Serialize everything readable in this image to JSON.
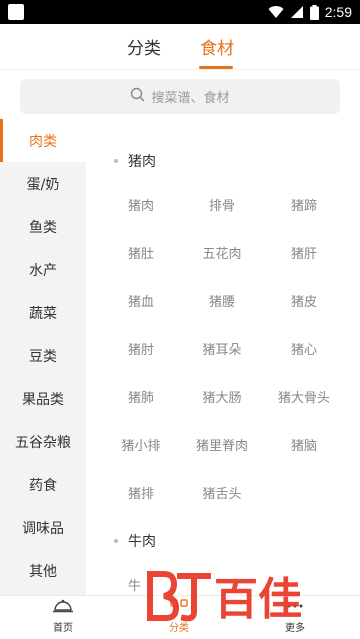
{
  "status_bar": {
    "time": "2:59"
  },
  "top_tabs": [
    {
      "label": "分类",
      "active": false
    },
    {
      "label": "食材",
      "active": true
    }
  ],
  "search": {
    "placeholder": "搜菜谱、食材"
  },
  "sidebar": {
    "items": [
      {
        "label": "肉类",
        "active": true
      },
      {
        "label": "蛋/奶"
      },
      {
        "label": "鱼类"
      },
      {
        "label": "水产"
      },
      {
        "label": "蔬菜"
      },
      {
        "label": "豆类"
      },
      {
        "label": "果品类"
      },
      {
        "label": "五谷杂粮"
      },
      {
        "label": "药食"
      },
      {
        "label": "调味品"
      },
      {
        "label": "其他"
      }
    ]
  },
  "sections": [
    {
      "title": "猪肉",
      "items": [
        "猪肉",
        "排骨",
        "猪蹄",
        "猪肚",
        "五花肉",
        "猪肝",
        "猪血",
        "猪腰",
        "猪皮",
        "猪肘",
        "猪耳朵",
        "猪心",
        "猪肺",
        "猪大肠",
        "猪大骨头",
        "猪小排",
        "猪里脊肉",
        "猪脑",
        "猪排",
        "猪舌头"
      ]
    },
    {
      "title": "牛肉",
      "items": [
        "牛"
      ]
    }
  ],
  "bottom_nav": [
    {
      "label": "首页",
      "icon": "home-icon"
    },
    {
      "label": "分类",
      "icon": "category-icon",
      "active": true
    },
    {
      "label": "更多",
      "icon": "more-icon"
    }
  ],
  "watermark": {
    "text": "百佳"
  },
  "colors": {
    "accent": "#e8731b",
    "sidebar_bg": "#f4f3f1",
    "search_bg": "#f2f1ef"
  }
}
